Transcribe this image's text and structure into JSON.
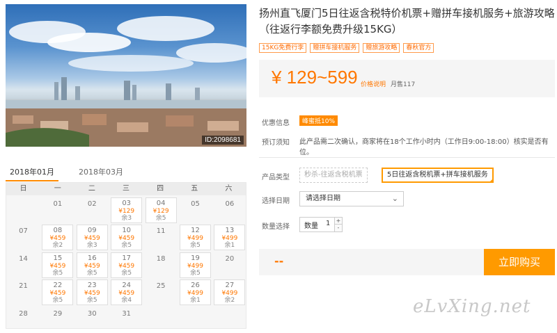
{
  "hero": {
    "id_label": "ID:2098681"
  },
  "calendar": {
    "tabs": [
      "2018年01月",
      "2018年03月"
    ],
    "weekdays": [
      "日",
      "一",
      "二",
      "三",
      "四",
      "五",
      "六"
    ],
    "stock_prefix": "余"
  },
  "product": {
    "title": "扬州直飞厦门5日往返含税特价机票+赠拼车接机服务+旅游攻略（往返行李额免费升级15KG）",
    "tags": [
      "15KG免费行李",
      "赠拼车接机服务",
      "赠旅游攻略",
      "春秋官方"
    ],
    "price": "¥ 129~599",
    "price_note": "价格说明",
    "sold": "月售117"
  },
  "info": {
    "coupon_label": "优惠信息",
    "coupon": "峰蜜抵10%",
    "notice_label": "预订须知",
    "notice": "此产品需二次确认，商家将在18个工作小时内（工作日9:00-18:00）核实是否有位。"
  },
  "options": {
    "type_label": "产品类型",
    "type_disabled": "秒杀-往返含税机票",
    "type_selected": "5日往返含税机票+拼车接机服务",
    "date_label": "选择日期",
    "date_placeholder": "请选择日期",
    "qty_label": "数量选择",
    "qty_prefix": "数量",
    "qty_value": "1"
  },
  "buy": {
    "total": "--",
    "button": "立即购买"
  },
  "watermark": "eLvXing.net",
  "calendar_days": [
    {
      "d": "01",
      "row": 0,
      "col": 1
    },
    {
      "d": "02",
      "row": 0,
      "col": 2
    },
    {
      "d": "03",
      "row": 0,
      "col": 3,
      "price": "¥129",
      "stock": "3"
    },
    {
      "d": "04",
      "row": 0,
      "col": 4,
      "price": "¥129",
      "stock": "5"
    },
    {
      "d": "05",
      "row": 0,
      "col": 5
    },
    {
      "d": "06",
      "row": 0,
      "col": 6
    },
    {
      "d": "07",
      "row": 1,
      "col": 0
    },
    {
      "d": "08",
      "row": 1,
      "col": 1,
      "price": "¥459",
      "stock": "2"
    },
    {
      "d": "09",
      "row": 1,
      "col": 2,
      "price": "¥459",
      "stock": "3"
    },
    {
      "d": "10",
      "row": 1,
      "col": 3,
      "price": "¥459",
      "stock": "5"
    },
    {
      "d": "11",
      "row": 1,
      "col": 4
    },
    {
      "d": "12",
      "row": 1,
      "col": 5,
      "price": "¥499",
      "stock": "5"
    },
    {
      "d": "13",
      "row": 1,
      "col": 6,
      "price": "¥499",
      "stock": "1"
    },
    {
      "d": "14",
      "row": 2,
      "col": 0
    },
    {
      "d": "15",
      "row": 2,
      "col": 1,
      "price": "¥459",
      "stock": "5"
    },
    {
      "d": "16",
      "row": 2,
      "col": 2,
      "price": "¥459",
      "stock": "5"
    },
    {
      "d": "17",
      "row": 2,
      "col": 3,
      "price": "¥459",
      "stock": "5"
    },
    {
      "d": "18",
      "row": 2,
      "col": 4
    },
    {
      "d": "19",
      "row": 2,
      "col": 5,
      "price": "¥499",
      "stock": "5"
    },
    {
      "d": "20",
      "row": 2,
      "col": 6
    },
    {
      "d": "21",
      "row": 3,
      "col": 0
    },
    {
      "d": "22",
      "row": 3,
      "col": 1,
      "price": "¥459",
      "stock": "5"
    },
    {
      "d": "23",
      "row": 3,
      "col": 2,
      "price": "¥459",
      "stock": "5"
    },
    {
      "d": "24",
      "row": 3,
      "col": 3,
      "price": "¥459",
      "stock": "4"
    },
    {
      "d": "25",
      "row": 3,
      "col": 4
    },
    {
      "d": "26",
      "row": 3,
      "col": 5,
      "price": "¥499",
      "stock": "1"
    },
    {
      "d": "27",
      "row": 3,
      "col": 6,
      "price": "¥499",
      "stock": "2"
    },
    {
      "d": "28",
      "row": 4,
      "col": 0
    },
    {
      "d": "29",
      "row": 4,
      "col": 1
    },
    {
      "d": "30",
      "row": 4,
      "col": 2
    },
    {
      "d": "31",
      "row": 4,
      "col": 3
    }
  ]
}
